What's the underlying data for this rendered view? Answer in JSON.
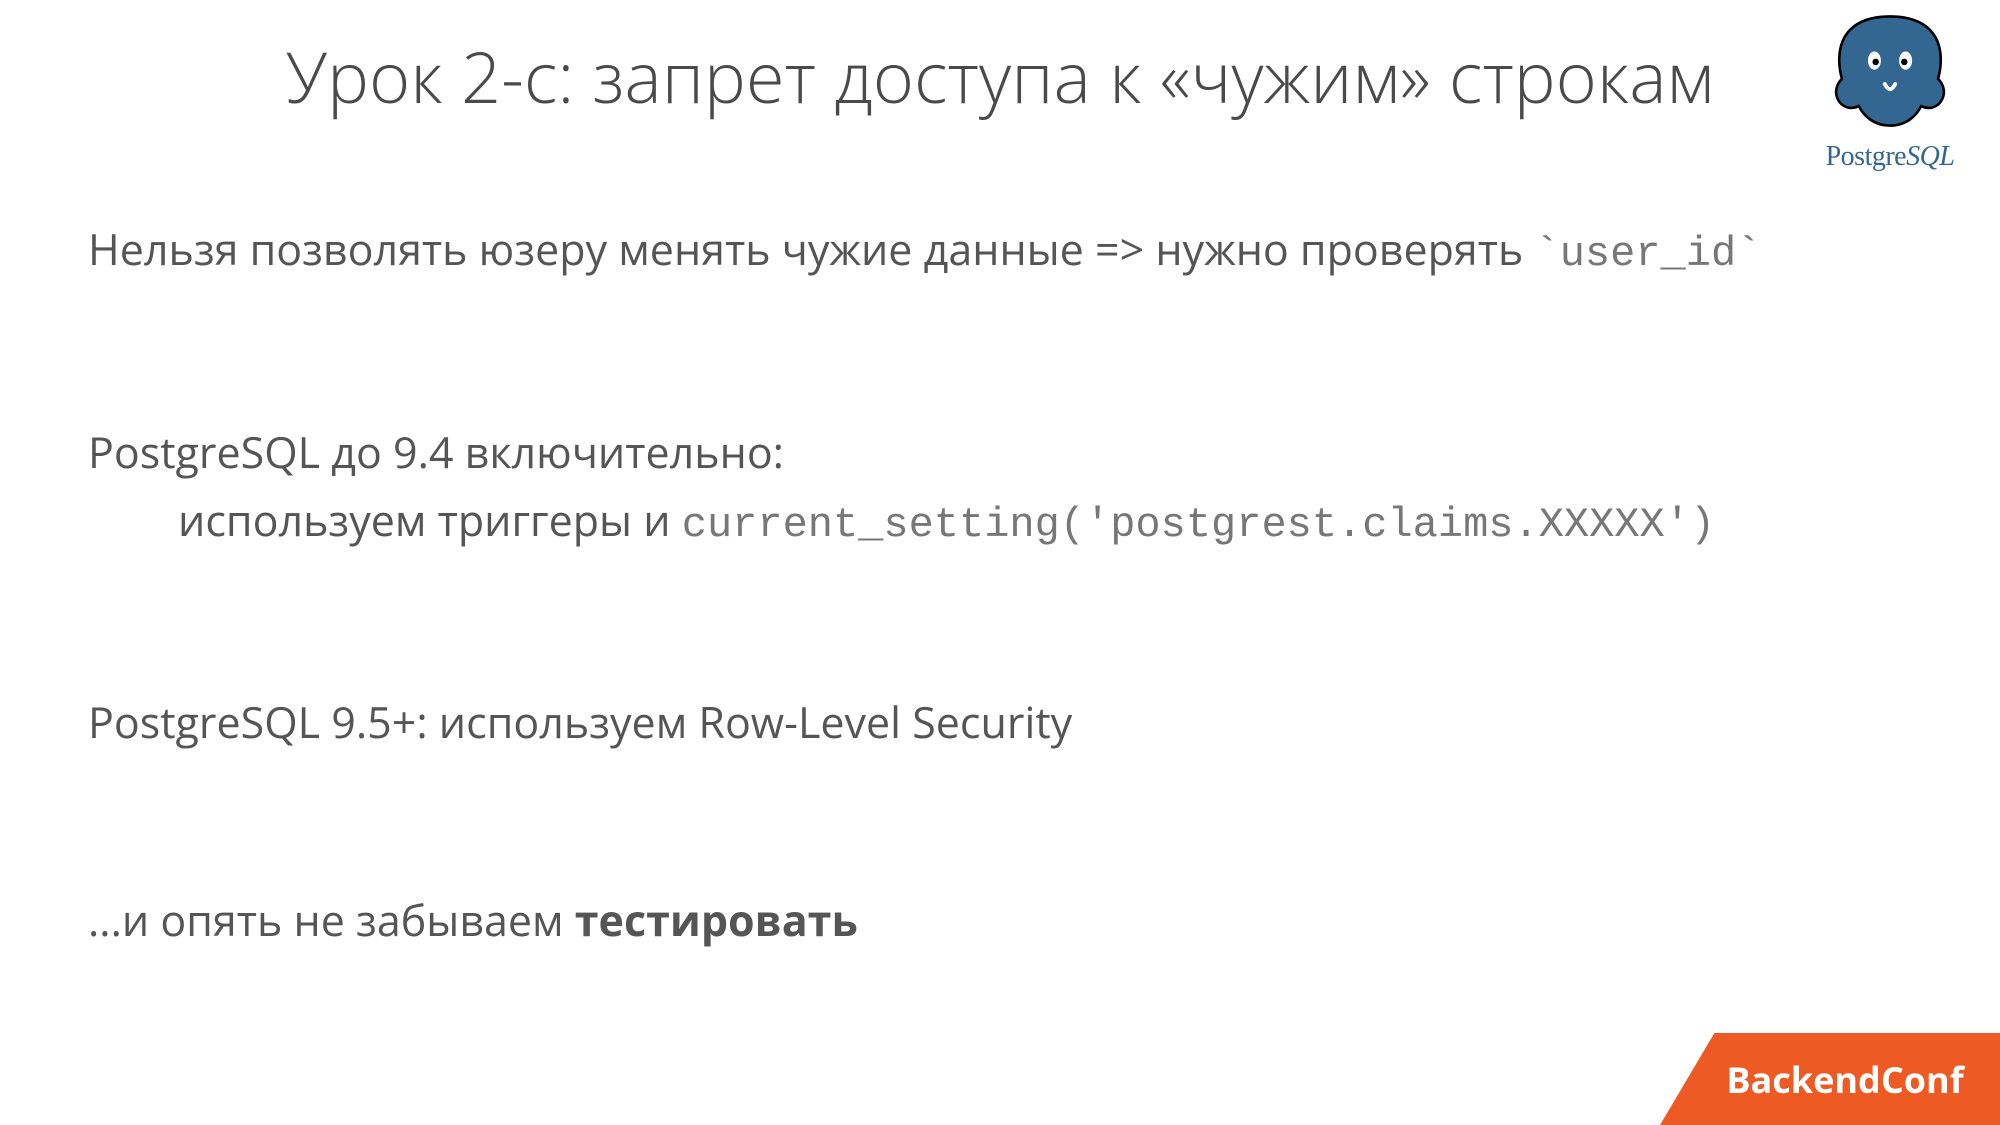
{
  "title": "Урок 2-c: запрет доступа к «чужим» строкам",
  "logo": {
    "wordmark_pre": "Postgre",
    "wordmark_sql": "SQL"
  },
  "p1": {
    "text_a": "Нельзя позволять юзеру менять чужие данные  =>  нужно проверять ",
    "code": "`user_id`"
  },
  "p2": {
    "line1": "PostgreSQL до 9.4 включительно:",
    "line2_text": "используем триггеры и ",
    "line2_code": "current_setting('postgrest.claims.XXXXX')"
  },
  "p3": {
    "text": "PostgreSQL 9.5+:  используем Row-Level Security"
  },
  "p4": {
    "text_a": "...и опять не забываем ",
    "bold": "тестировать"
  },
  "badge": "BackendConf"
}
